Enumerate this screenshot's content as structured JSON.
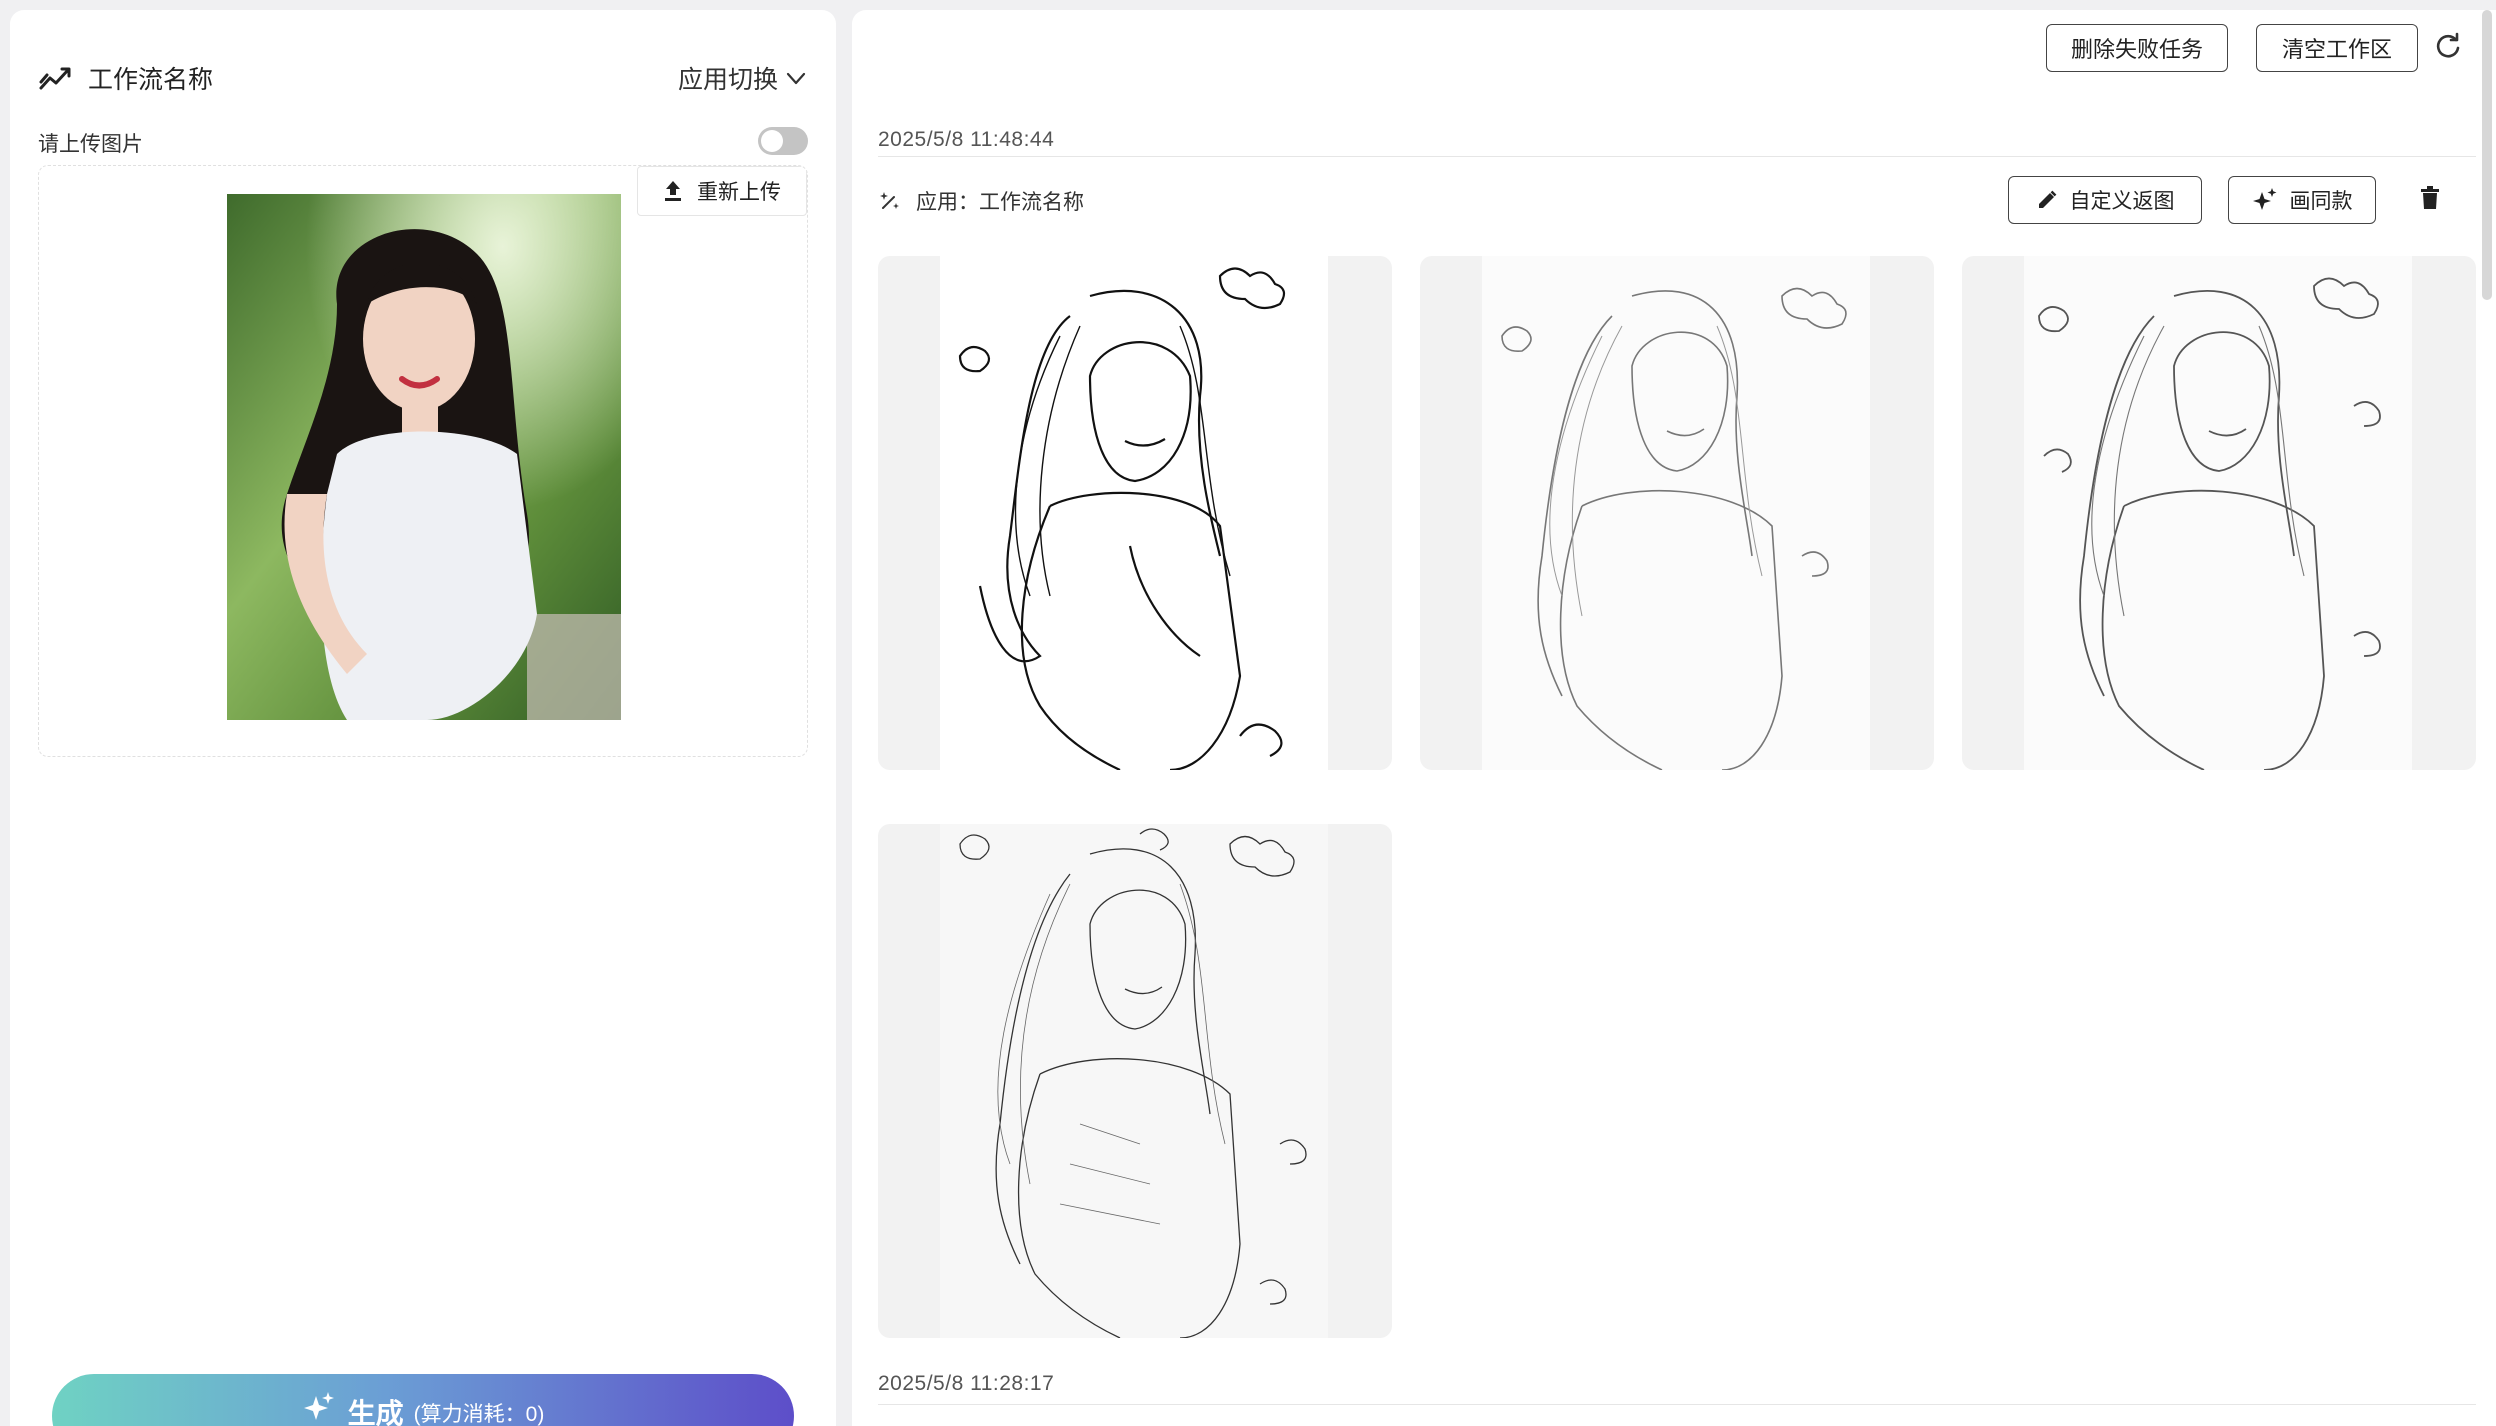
{
  "left": {
    "workflow_title": "工作流名称",
    "app_switch_label": "应用切换",
    "upload_label": "请上传图片",
    "toggle_on": false,
    "reupload_label": "重新上传",
    "generate_label": "生成",
    "generate_cost": "(算力消耗：0)"
  },
  "right": {
    "delete_failed_label": "删除失败任务",
    "clear_workspace_label": "清空工作区",
    "tasks": [
      {
        "timestamp": "2025/5/8 11:48:44",
        "app_text": "应用：工作流名称",
        "custom_return_label": "自定义返图",
        "same_style_label": "画同款",
        "results": [
          "sketch-1",
          "sketch-2",
          "sketch-3",
          "sketch-4"
        ]
      },
      {
        "timestamp": "2025/5/8 11:28:17"
      }
    ]
  },
  "colors": {
    "accent_gradient": [
      "#6fd2c3",
      "#6b9ed5",
      "#5d4ec9"
    ],
    "toggle_off": "#c4c4c4",
    "card_bg": "#f2f2f2"
  }
}
